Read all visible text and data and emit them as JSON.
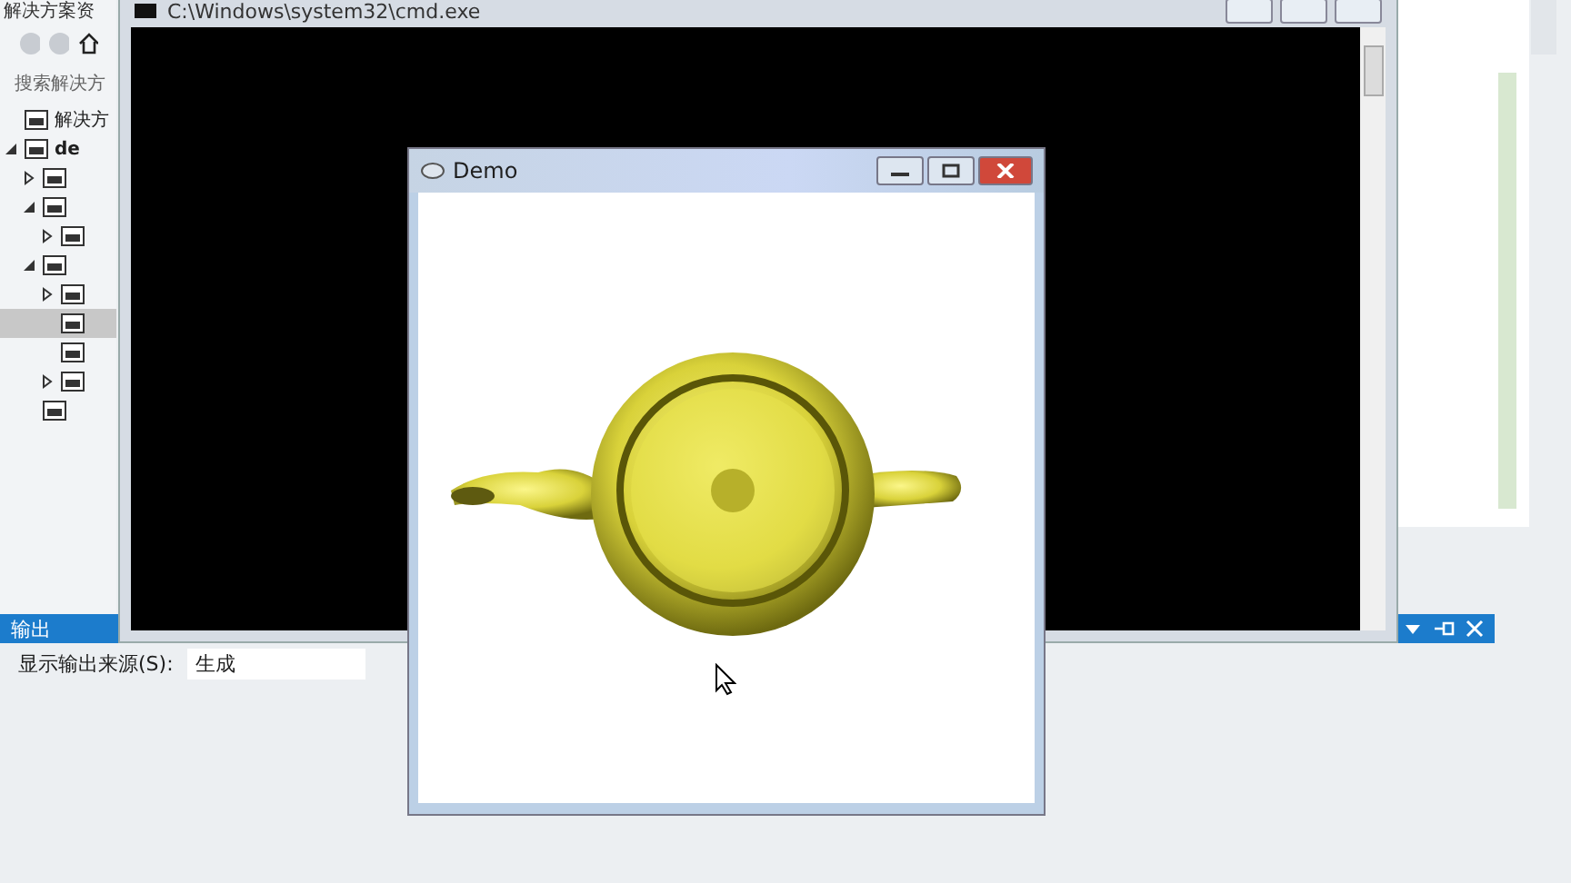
{
  "solution_explorer": {
    "title": "解决方案资",
    "search": {
      "placeholder": "搜索解决方"
    },
    "tree": [
      {
        "label": "解决方",
        "selected": false
      },
      {
        "label": "de",
        "selected": false,
        "expanded": true,
        "children": [
          {
            "selected": false,
            "expanded": false
          },
          {
            "selected": false,
            "expanded": true,
            "children": [
              {
                "selected": false,
                "expanded": false
              }
            ]
          },
          {
            "selected": false,
            "expanded": true,
            "children": [
              {
                "selected": false,
                "expanded": false
              },
              {
                "selected": true
              },
              {
                "selected": false
              },
              {
                "selected": false,
                "expanded": false
              }
            ]
          },
          {
            "selected": false
          }
        ]
      }
    ]
  },
  "console": {
    "title": "C:\\Windows\\system32\\cmd.exe"
  },
  "output": {
    "title": "输出",
    "source_label": "显示输出来源(S):",
    "source_value": "生成"
  },
  "demo": {
    "title": "Demo"
  }
}
